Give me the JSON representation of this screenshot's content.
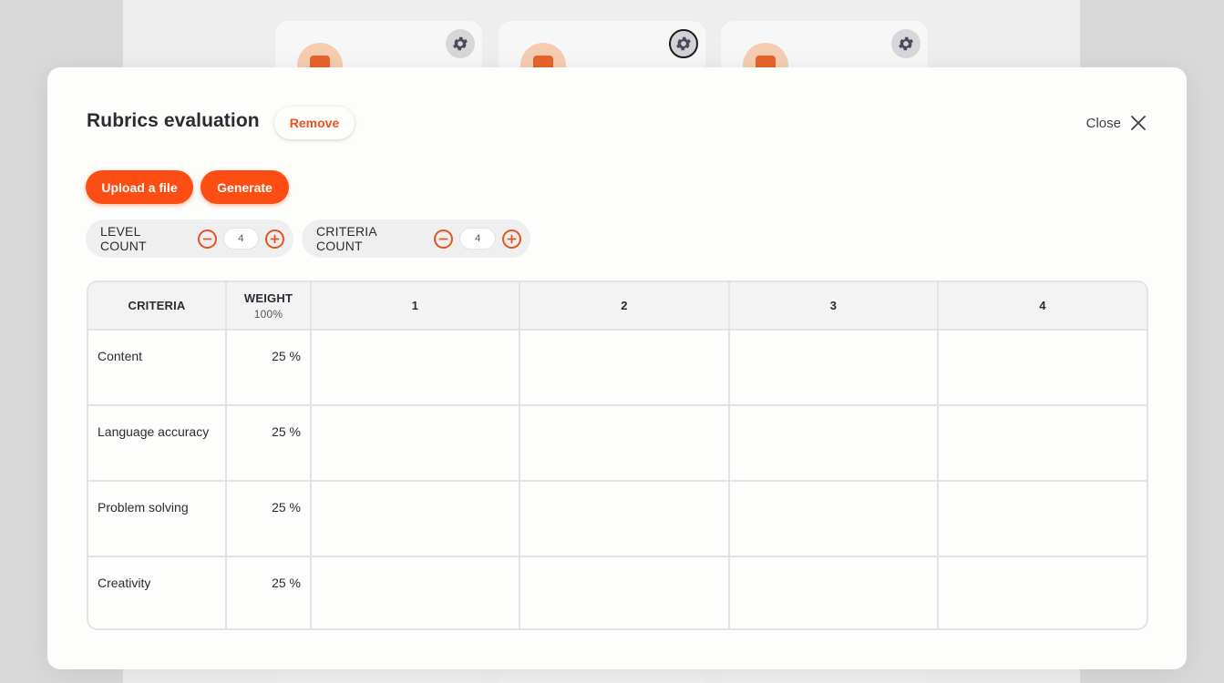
{
  "modal": {
    "title": "Rubrics evaluation",
    "remove_label": "Remove",
    "close_label": "Close",
    "upload_label": "Upload a file",
    "generate_label": "Generate"
  },
  "counters": {
    "level": {
      "label": "LEVEL COUNT",
      "value": "4"
    },
    "criteria": {
      "label": "CRITERIA COUNT",
      "value": "4"
    }
  },
  "table": {
    "headers": {
      "criteria": "CRITERIA",
      "weight": "WEIGHT",
      "weight_total": "100%",
      "levels": [
        "1",
        "2",
        "3",
        "4"
      ]
    },
    "rows": [
      {
        "criteria": "Content",
        "weight": "25 %"
      },
      {
        "criteria": "Language accuracy",
        "weight": "25 %"
      },
      {
        "criteria": "Problem solving",
        "weight": "25 %"
      },
      {
        "criteria": "Creativity",
        "weight": "25 %"
      }
    ]
  },
  "colors": {
    "accent": "#fc4e12",
    "accent_text": "#e8521f",
    "modal_bg": "#fdfdfc",
    "overlay_bg": "#d9d9d9"
  },
  "icons": {
    "close": "close-icon",
    "minus": "minus-circle-icon",
    "plus": "plus-circle-icon",
    "gear": "gear-icon"
  }
}
